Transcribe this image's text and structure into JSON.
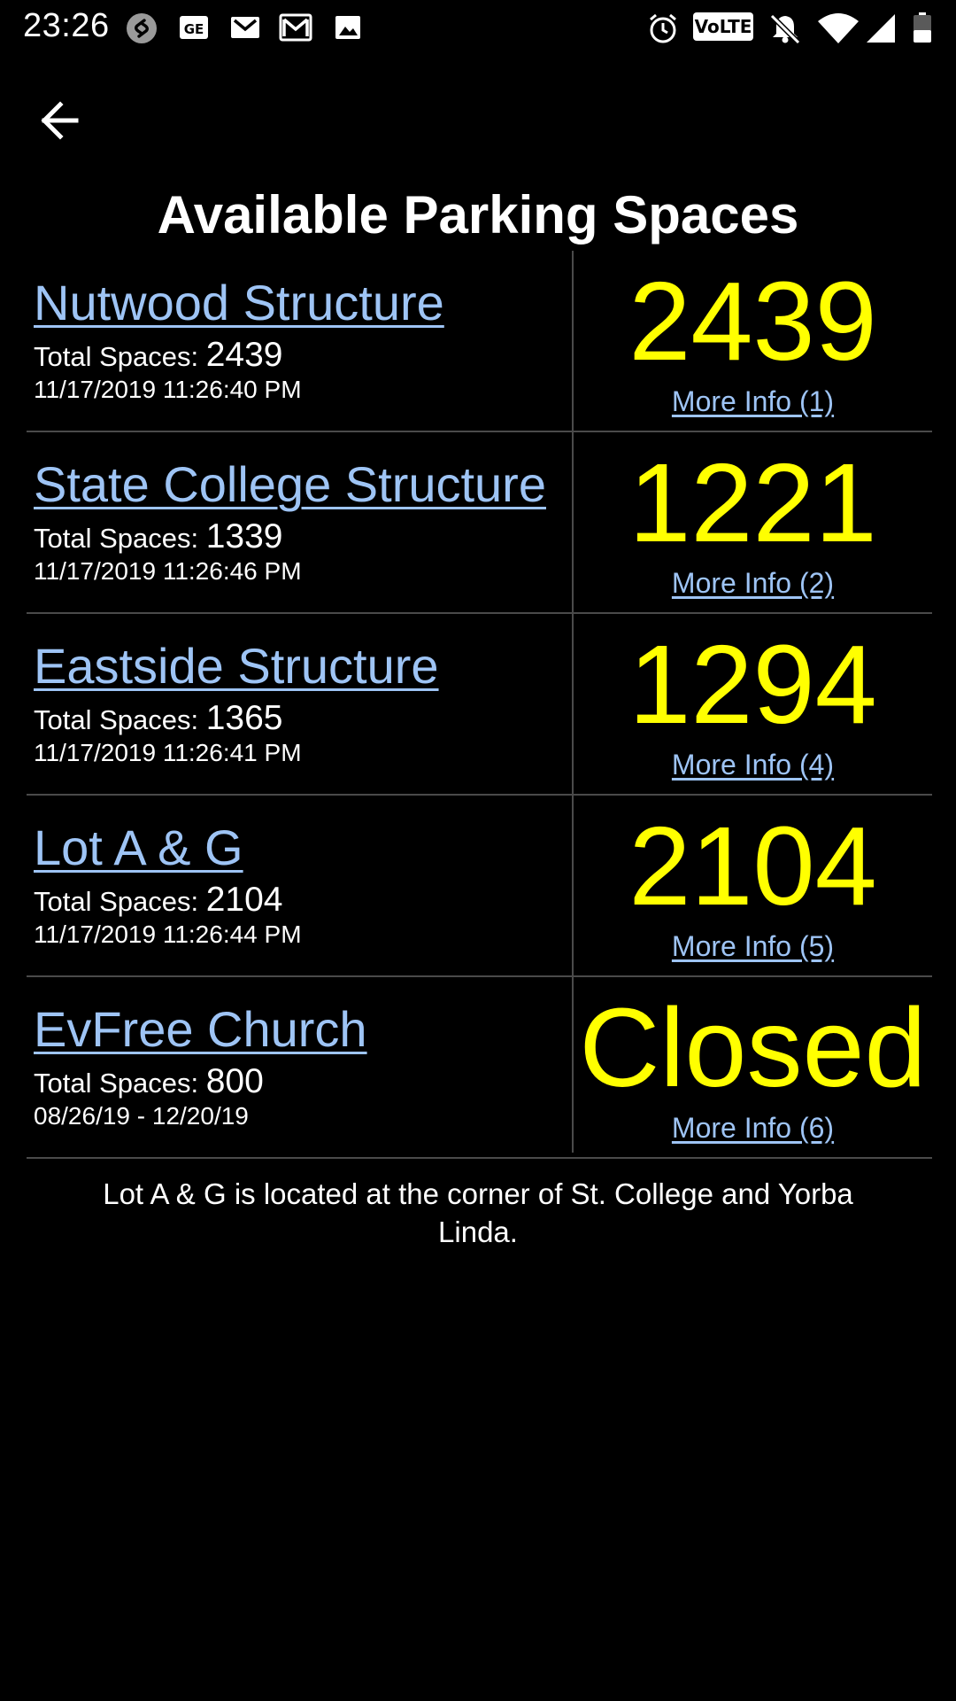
{
  "status_bar": {
    "time": "23:26",
    "network_badge": "VoLTE",
    "left_icons": [
      "shazam-icon",
      "ge-news-icon",
      "gmail-icon",
      "gmail-outline-icon",
      "gallery-icon"
    ],
    "right_icons": [
      "alarm-icon",
      "volte-icon",
      "notifications-off-icon",
      "wifi-icon",
      "signal-icon",
      "battery-icon"
    ]
  },
  "header": {
    "back_icon": "arrow-left-icon",
    "title": "Available Parking Spaces"
  },
  "colors": {
    "background": "#000000",
    "link": "#9ec4f5",
    "available_count": "#ffff00",
    "divider": "#4a4a4a"
  },
  "lots": [
    {
      "name": "Nutwood Structure",
      "total_label": "Total Spaces:",
      "total": "2439",
      "updated": "11/17/2019 11:26:40 PM",
      "available": "2439",
      "more_info": "More Info (1)"
    },
    {
      "name": "State College Structure",
      "total_label": "Total Spaces:",
      "total": "1339",
      "updated": "11/17/2019 11:26:46 PM",
      "available": "1221",
      "more_info": "More Info (2)"
    },
    {
      "name": "Eastside Structure",
      "total_label": "Total Spaces:",
      "total": "1365",
      "updated": "11/17/2019 11:26:41 PM",
      "available": "1294",
      "more_info": "More Info (4)"
    },
    {
      "name": "Lot A & G",
      "total_label": "Total Spaces:",
      "total": "2104",
      "updated": "11/17/2019 11:26:44 PM",
      "available": "2104",
      "more_info": "More Info (5)"
    },
    {
      "name": "EvFree Church",
      "total_label": "Total Spaces:",
      "total": "800",
      "updated": "08/26/19 - 12/20/19",
      "available": "Closed",
      "more_info": "More Info (6)"
    }
  ],
  "footnote": "Lot A & G is located at the corner of St. College and Yorba Linda."
}
